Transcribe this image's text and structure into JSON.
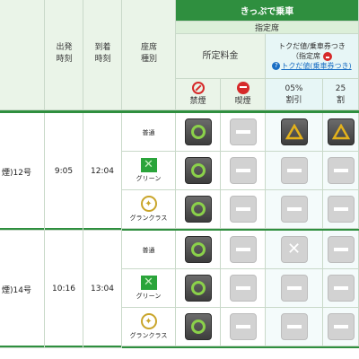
{
  "header": {
    "group_title": "きっぷで乗車",
    "reserved_label": "指定席",
    "fare_label": "所定料金",
    "discount_title": "トクだ値/乗車券つき",
    "discount_sub": "（指定席",
    "discount_help": "トクだ値(乗車券つき)",
    "col_departure": "出発\n時刻",
    "col_arrival": "到着\n時刻",
    "col_seat": "座席\n種別",
    "col_nonsmoking": "禁煙",
    "col_smoking": "喫煙",
    "col_disc5_pct": "05%",
    "col_disc5_lbl": "割引",
    "col_disc25_pct": "25",
    "col_disc25_lbl": "割"
  },
  "icons": {
    "nonsmoking": "no-smoking-icon",
    "smoking": "smoking-icon",
    "green": "green-car-icon",
    "gran": "gran-class-icon",
    "status_ok": "circle-available-icon",
    "status_na": "dash-unavailable-icon",
    "status_few": "triangle-few-icon",
    "status_full": "cross-full-icon"
  },
  "colors": {
    "accent": "#2f8f3f",
    "available_ring": "#8bd14a",
    "few": "#e3b21b"
  },
  "trains": [
    {
      "name": "煙)12号",
      "dep": "9:05",
      "arr": "12:04",
      "rows": [
        {
          "seat": "普通",
          "seat_icon": "",
          "status": [
            "ok",
            "na",
            "few",
            "few"
          ]
        },
        {
          "seat": "グリーン",
          "seat_icon": "green",
          "status": [
            "ok",
            "na",
            "na",
            "na"
          ]
        },
        {
          "seat": "グランクラス",
          "seat_icon": "gran",
          "status": [
            "ok",
            "na",
            "na",
            "na"
          ]
        }
      ]
    },
    {
      "name": "煙)14号",
      "dep": "10:16",
      "arr": "13:04",
      "rows": [
        {
          "seat": "普通",
          "seat_icon": "",
          "status": [
            "ok",
            "na",
            "full",
            "na"
          ]
        },
        {
          "seat": "グリーン",
          "seat_icon": "green",
          "status": [
            "ok",
            "na",
            "na",
            "na"
          ]
        },
        {
          "seat": "グランクラス",
          "seat_icon": "gran",
          "status": [
            "ok",
            "na",
            "na",
            "na"
          ]
        }
      ]
    }
  ]
}
